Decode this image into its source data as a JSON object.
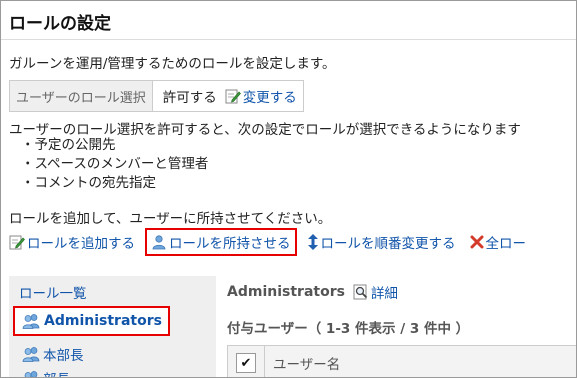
{
  "page": {
    "title": "ロールの設定",
    "description": "ガルーンを運用/管理するためのロールを設定します。"
  },
  "setting": {
    "label": "ユーザーのロール選択",
    "value": "許可する",
    "change_link": "変更する"
  },
  "info": {
    "text": "ユーザーのロール選択を許可すると、次の設定でロールが選択できるようになります",
    "bullets": [
      "・予定の公開先",
      "・スペースのメンバーと管理者",
      "・コメントの宛先指定"
    ]
  },
  "add_description": "ロールを追加して、ユーザーに所持させてください。",
  "toolbar": {
    "add_role": "ロールを追加する",
    "assign_role": "ロールを所持させる",
    "reorder_role": "ロールを順番変更する",
    "delete_all": "全ロー"
  },
  "role_list": {
    "title": "ロール一覧",
    "items": [
      "Administrators",
      "本部長",
      "部長"
    ]
  },
  "detail": {
    "role_name": "Administrators",
    "detail_link": "詳細",
    "user_count": "付与ユーザー（ 1-3 件表示 / 3 件中 ）",
    "column_user": "ユーザー名",
    "checkbox_mark": "✔"
  },
  "colors": {
    "link": "#1155aa",
    "highlight": "#e60000",
    "pane_bg": "#efefef"
  }
}
